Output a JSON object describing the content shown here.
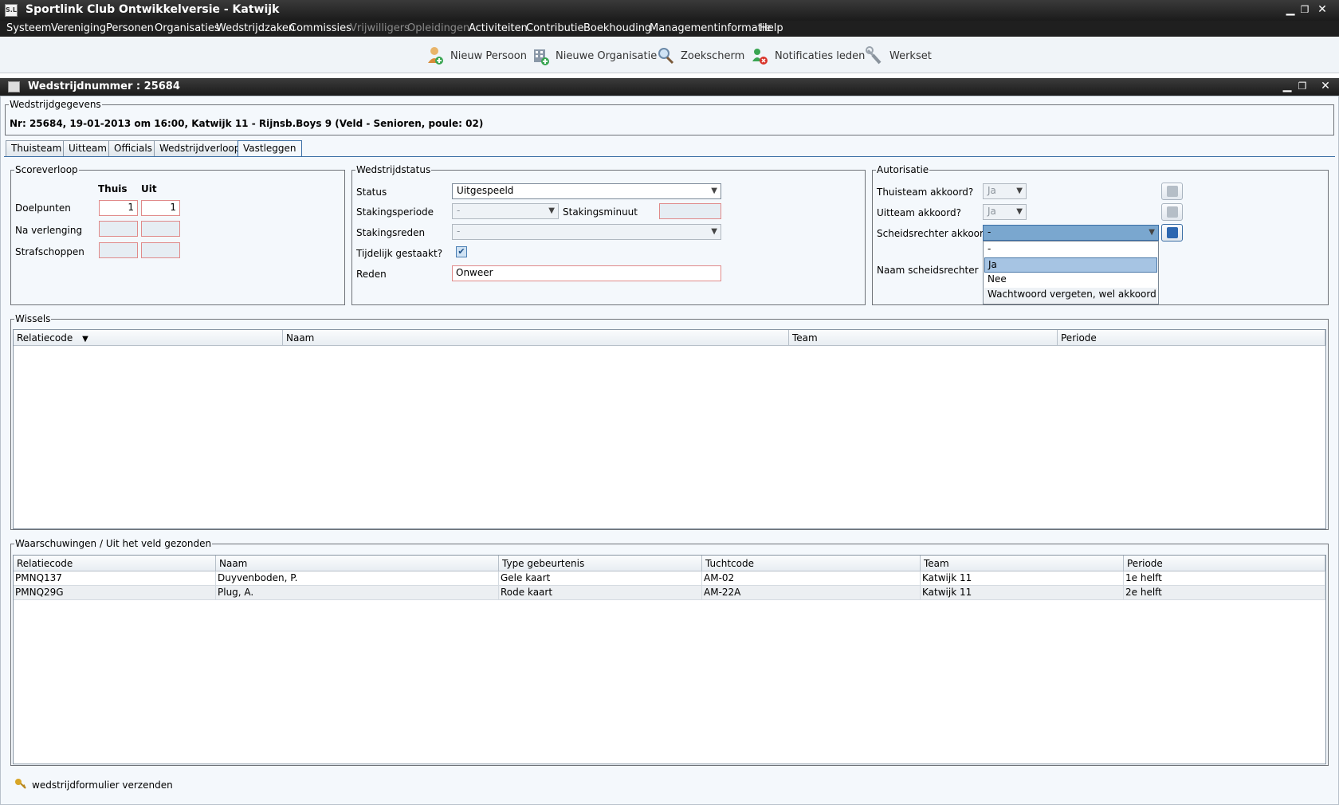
{
  "app": {
    "title": "Sportlink Club Ontwikkelversie - Katwijk",
    "icon_text": "S.L"
  },
  "menu": [
    {
      "label": "Systeem",
      "enabled": true
    },
    {
      "label": "Vereniging",
      "enabled": true
    },
    {
      "label": "Personen",
      "enabled": true
    },
    {
      "label": "Organisaties",
      "enabled": true
    },
    {
      "label": "Wedstrijdzaken",
      "enabled": true
    },
    {
      "label": "Commissies",
      "enabled": true
    },
    {
      "label": "Vrijwilligers",
      "enabled": false
    },
    {
      "label": "Opleidingen",
      "enabled": false
    },
    {
      "label": "Activiteiten",
      "enabled": true
    },
    {
      "label": "Contributie",
      "enabled": true
    },
    {
      "label": "Boekhouding",
      "enabled": true
    },
    {
      "label": "Managementinformatie",
      "enabled": true
    },
    {
      "label": "Help",
      "enabled": true
    }
  ],
  "toolbar": [
    {
      "label": "Nieuw Persoon",
      "icon": "person-add-icon"
    },
    {
      "label": "Nieuwe Organisatie",
      "icon": "organisation-add-icon"
    },
    {
      "label": "Zoekscherm",
      "icon": "magnifier-icon"
    },
    {
      "label": "Notificaties leden",
      "icon": "notification-icon"
    },
    {
      "label": "Werkset",
      "icon": "wrench-icon"
    }
  ],
  "window": {
    "title": "Wedstrijdnummer : 25684"
  },
  "wedstrijdgegevens": {
    "legend": "Wedstrijdgegevens",
    "text": "Nr: 25684, 19-01-2013 om 16:00, Katwijk 11 - Rijnsb.Boys 9 (Veld - Senioren, poule: 02)"
  },
  "tabs": [
    {
      "label": "Thuisteam",
      "active": false
    },
    {
      "label": "Uitteam",
      "active": false
    },
    {
      "label": "Officials",
      "active": false
    },
    {
      "label": "Wedstrijdverloop",
      "active": false
    },
    {
      "label": "Vastleggen",
      "active": true
    }
  ],
  "scoreverloop": {
    "legend": "Scoreverloop",
    "col_thuis": "Thuis",
    "col_uit": "Uit",
    "doelpunten_label": "Doelpunten",
    "doelpunten_thuis": "1",
    "doelpunten_uit": "1",
    "verlenging_label": "Na verlenging",
    "strafschoppen_label": "Strafschoppen"
  },
  "wedstrijdstatus": {
    "legend": "Wedstrijdstatus",
    "status_label": "Status",
    "status_value": "Uitgespeeld",
    "stakingsperiode_label": "Stakingsperiode",
    "stakingsperiode_value": "-",
    "stakingsminuut_label": "Stakingsminuut",
    "stakingsreden_label": "Stakingsreden",
    "stakingsreden_value": "-",
    "tijdelijk_label": "Tijdelijk gestaakt?",
    "tijdelijk_checked": true,
    "reden_label": "Reden",
    "reden_value": "Onweer"
  },
  "autorisatie": {
    "legend": "Autorisatie",
    "thuis_label": "Thuisteam akkoord?",
    "thuis_value": "Ja",
    "uit_label": "Uitteam akkoord?",
    "uit_value": "Ja",
    "scheids_label": "Scheidsrechter akkoord?",
    "scheids_value": "-",
    "naam_label": "Naam scheidsrechter",
    "dropdown_options": [
      "-",
      "Ja",
      "Nee",
      "Wachtwoord vergeten, wel akkoord"
    ],
    "dropdown_highlighted": "Ja"
  },
  "wissels": {
    "legend": "Wissels",
    "columns": [
      "Relatiecode",
      "Naam",
      "Team",
      "Periode"
    ],
    "rows": []
  },
  "waarschuwingen": {
    "legend": "Waarschuwingen / Uit het veld gezonden",
    "columns": [
      "Relatiecode",
      "Naam",
      "Type gebeurtenis",
      "Tuchtcode",
      "Team",
      "Periode"
    ],
    "rows": [
      [
        "PMNQ137",
        "Duyvenboden, P.",
        "Gele kaart",
        "AM-02",
        "Katwijk 11",
        "1e helft"
      ],
      [
        "PMNQ29G",
        "Plug, A.",
        "Rode kaart",
        "AM-22A",
        "Katwijk 11",
        "2e helft"
      ]
    ]
  },
  "footer": {
    "action_label": "wedstrijdformulier verzenden",
    "icon": "key-icon"
  },
  "colors": {
    "accent": "#3a6ea5",
    "titlebar": "#1f1f1f",
    "panel": "#f4f8fc",
    "selection": "#a6c4e3"
  }
}
